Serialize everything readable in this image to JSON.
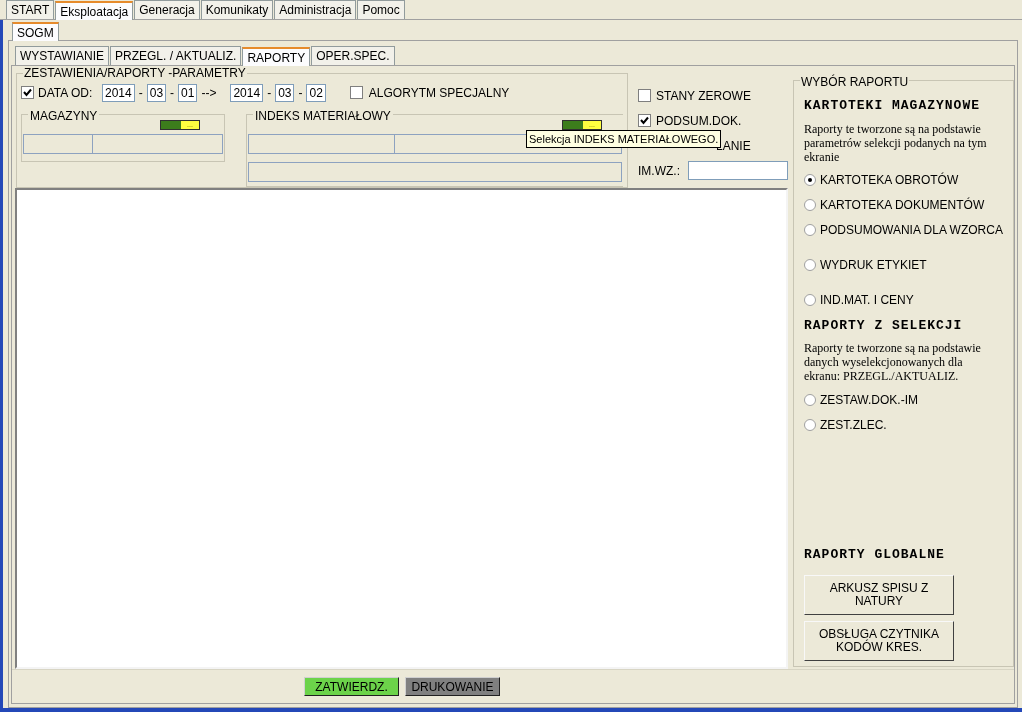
{
  "menu_tabs": [
    {
      "label": "START",
      "selected": false
    },
    {
      "label": "Eksploatacja",
      "selected": true
    },
    {
      "label": "Generacja",
      "selected": false
    },
    {
      "label": "Komunikaty",
      "selected": false
    },
    {
      "label": "Administracja",
      "selected": false
    },
    {
      "label": "Pomoc",
      "selected": false
    }
  ],
  "module_tabs": [
    {
      "label": "SOGM",
      "selected": true
    }
  ],
  "sub_tabs": [
    {
      "label": "WYSTAWIANIE",
      "selected": false
    },
    {
      "label": "PRZEGL. / AKTUALIZ.",
      "selected": false
    },
    {
      "label": "RAPORTY",
      "selected": true
    },
    {
      "label": "OPER.SPEC.",
      "selected": false
    }
  ],
  "parameters": {
    "title": "ZESTAWIENIA/RAPORTY -PARAMETRY",
    "date_filter": {
      "label": "DATA OD:",
      "checked": true,
      "parts": [
        {
          "kind": "field",
          "value": "2014"
        },
        {
          "kind": "separator",
          "value": "-"
        },
        {
          "kind": "field",
          "value": "03"
        },
        {
          "kind": "separator",
          "value": "-"
        },
        {
          "kind": "field",
          "value": "01"
        },
        {
          "kind": "separator",
          "value": "-->"
        },
        {
          "kind": "field",
          "value": "2014"
        },
        {
          "kind": "separator",
          "value": "-"
        },
        {
          "kind": "field",
          "value": "03"
        },
        {
          "kind": "separator",
          "value": "-"
        },
        {
          "kind": "field",
          "value": "02"
        }
      ]
    },
    "special_algorithm": {
      "label": "ALGORYTM SPECJALNY",
      "checked": false
    },
    "warehouses": {
      "title": "MAGAZYNY",
      "select_button": "..."
    },
    "material_index": {
      "title": "INDEKS MATERIAŁOWY",
      "select_button": "...",
      "tooltip": "Selekcja INDEKS MATERIAŁOWEGO."
    },
    "options": [
      {
        "kind": "checkbox",
        "label": "STANY ZEROWE",
        "checked": false
      },
      {
        "kind": "checkbox",
        "label": "PODSUM.DOK.",
        "checked": true
      },
      {
        "kind": "text",
        "label": "LANIE"
      },
      {
        "kind": "field",
        "label": "IM.WZ.:"
      }
    ]
  },
  "report_choice": {
    "title": "WYBÓR RAPORTU",
    "sections": [
      {
        "heading": "KARTOTEKI MAGAZYNOWE",
        "note": "Raporty te tworzone są na podstawie parametrów selekcji podanych na tym ekranie",
        "options": [
          {
            "label": "KARTOTEKA OBROTÓW",
            "selected": true
          },
          {
            "label": "KARTOTEKA DOKUMENTÓW",
            "selected": false
          },
          {
            "label": "PODSUMOWANIA DLA WZORCA",
            "selected": false
          },
          {
            "label": "WYDRUK ETYKIET",
            "selected": false
          },
          {
            "label": "IND.MAT. I CENY",
            "selected": false
          }
        ]
      },
      {
        "heading": "RAPORTY Z SELEKCJI",
        "note": "Raporty te tworzone są na podstawie danych wyselekcjonowanych dla ekranu:  PRZEGL./AKTUALIZ.",
        "options": [
          {
            "label": "ZESTAW.DOK.-IM",
            "selected": false
          },
          {
            "label": "ZEST.ZLEC.",
            "selected": false
          }
        ]
      },
      {
        "heading": "RAPORTY GLOBALNE",
        "buttons": [
          "ARKUSZ SPISU Z NATURY",
          "OBSŁUGA CZYTNIKA KODÓW KRES."
        ]
      }
    ]
  },
  "footer_buttons": [
    {
      "kind": "confirm",
      "label": "ZATWIERDZ."
    },
    {
      "kind": "print",
      "label": "DRUKOWANIE"
    }
  ]
}
